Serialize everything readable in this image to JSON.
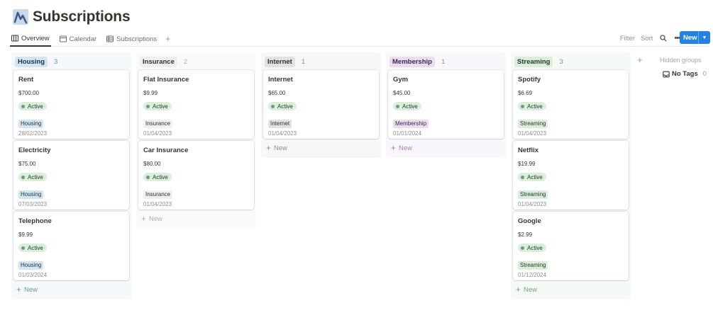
{
  "page": {
    "title": "Subscriptions",
    "icon": "chart-line-icon"
  },
  "tabs": [
    {
      "label": "Overview",
      "icon": "board-view-icon",
      "active": true
    },
    {
      "label": "Calendar",
      "icon": "calendar-icon",
      "active": false
    },
    {
      "label": "Subscriptions",
      "icon": "table-view-icon",
      "active": false
    }
  ],
  "toolbar": {
    "filter_label": "Filter",
    "sort_label": "Sort",
    "new_label": "New"
  },
  "colors": {
    "accent": "#2383e2",
    "status_bg": "#dbeddb",
    "status_dot": "#6c9b7d"
  },
  "columns": [
    {
      "name": "Housing",
      "count": "3",
      "tag_bg": "#d3e5ef",
      "tag_color": "#183347",
      "bg": "#f5f9fc",
      "muted": "#6e93ad",
      "cards": [
        {
          "title": "Rent",
          "price": "$700.00",
          "status": "Active",
          "tag": "Housing",
          "date": "28/02/2023"
        },
        {
          "title": "Electricity",
          "price": "$75.00",
          "status": "Active",
          "tag": "Housing",
          "date": "07/03/2023"
        },
        {
          "title": "Telephone",
          "price": "$9.99",
          "status": "Active",
          "tag": "Housing",
          "date": "01/03/2024"
        }
      ],
      "new_label": "New"
    },
    {
      "name": "Insurance",
      "count": "2",
      "tag_bg": "#f1f0ef",
      "tag_color": "#32302c",
      "bg": "#fafaf9",
      "muted": "#b2b1ad",
      "cards": [
        {
          "title": "Flat Insurance",
          "price": "$9.99",
          "status": "Active",
          "tag": "Insurance",
          "date": "01/04/2023"
        },
        {
          "title": "Car Insurance",
          "price": "$80.00",
          "status": "Active",
          "tag": "Insurance",
          "date": "01/04/2023"
        }
      ],
      "new_label": "New"
    },
    {
      "name": "Internet",
      "count": "1",
      "tag_bg": "#e3e2e0",
      "tag_color": "#32302c",
      "bg": "#f7f7f5",
      "muted": "#8f8e8a",
      "cards": [
        {
          "title": "Internet",
          "price": "$65.00",
          "status": "Active",
          "tag": "Internet",
          "date": "01/04/2023"
        }
      ],
      "new_label": "New"
    },
    {
      "name": "Membership",
      "count": "1",
      "tag_bg": "#e8deee",
      "tag_color": "#412454",
      "bg": "#faf7fc",
      "muted": "#9d83b0",
      "cards": [
        {
          "title": "Gym",
          "price": "$45.00",
          "status": "Active",
          "tag": "Membership",
          "date": "01/01/2024"
        }
      ],
      "new_label": "New"
    },
    {
      "name": "Streaming",
      "count": "3",
      "tag_bg": "#dbeddb",
      "tag_color": "#1c3829",
      "bg": "#f6faf6",
      "muted": "#75a083",
      "cards": [
        {
          "title": "Spotify",
          "price": "$6.69",
          "status": "Active",
          "tag": "Streaming",
          "date": "01/04/2023"
        },
        {
          "title": "Netflix",
          "price": "$19.99",
          "status": "Active",
          "tag": "Streaming",
          "date": "01/04/2023"
        },
        {
          "title": "Google",
          "price": "$2.99",
          "status": "Active",
          "tag": "Streaming",
          "date": "01/12/2024"
        }
      ],
      "new_label": "New"
    }
  ],
  "hidden": {
    "title": "Hidden groups",
    "no_tags_label": "No Tags",
    "no_tags_count": "0"
  }
}
